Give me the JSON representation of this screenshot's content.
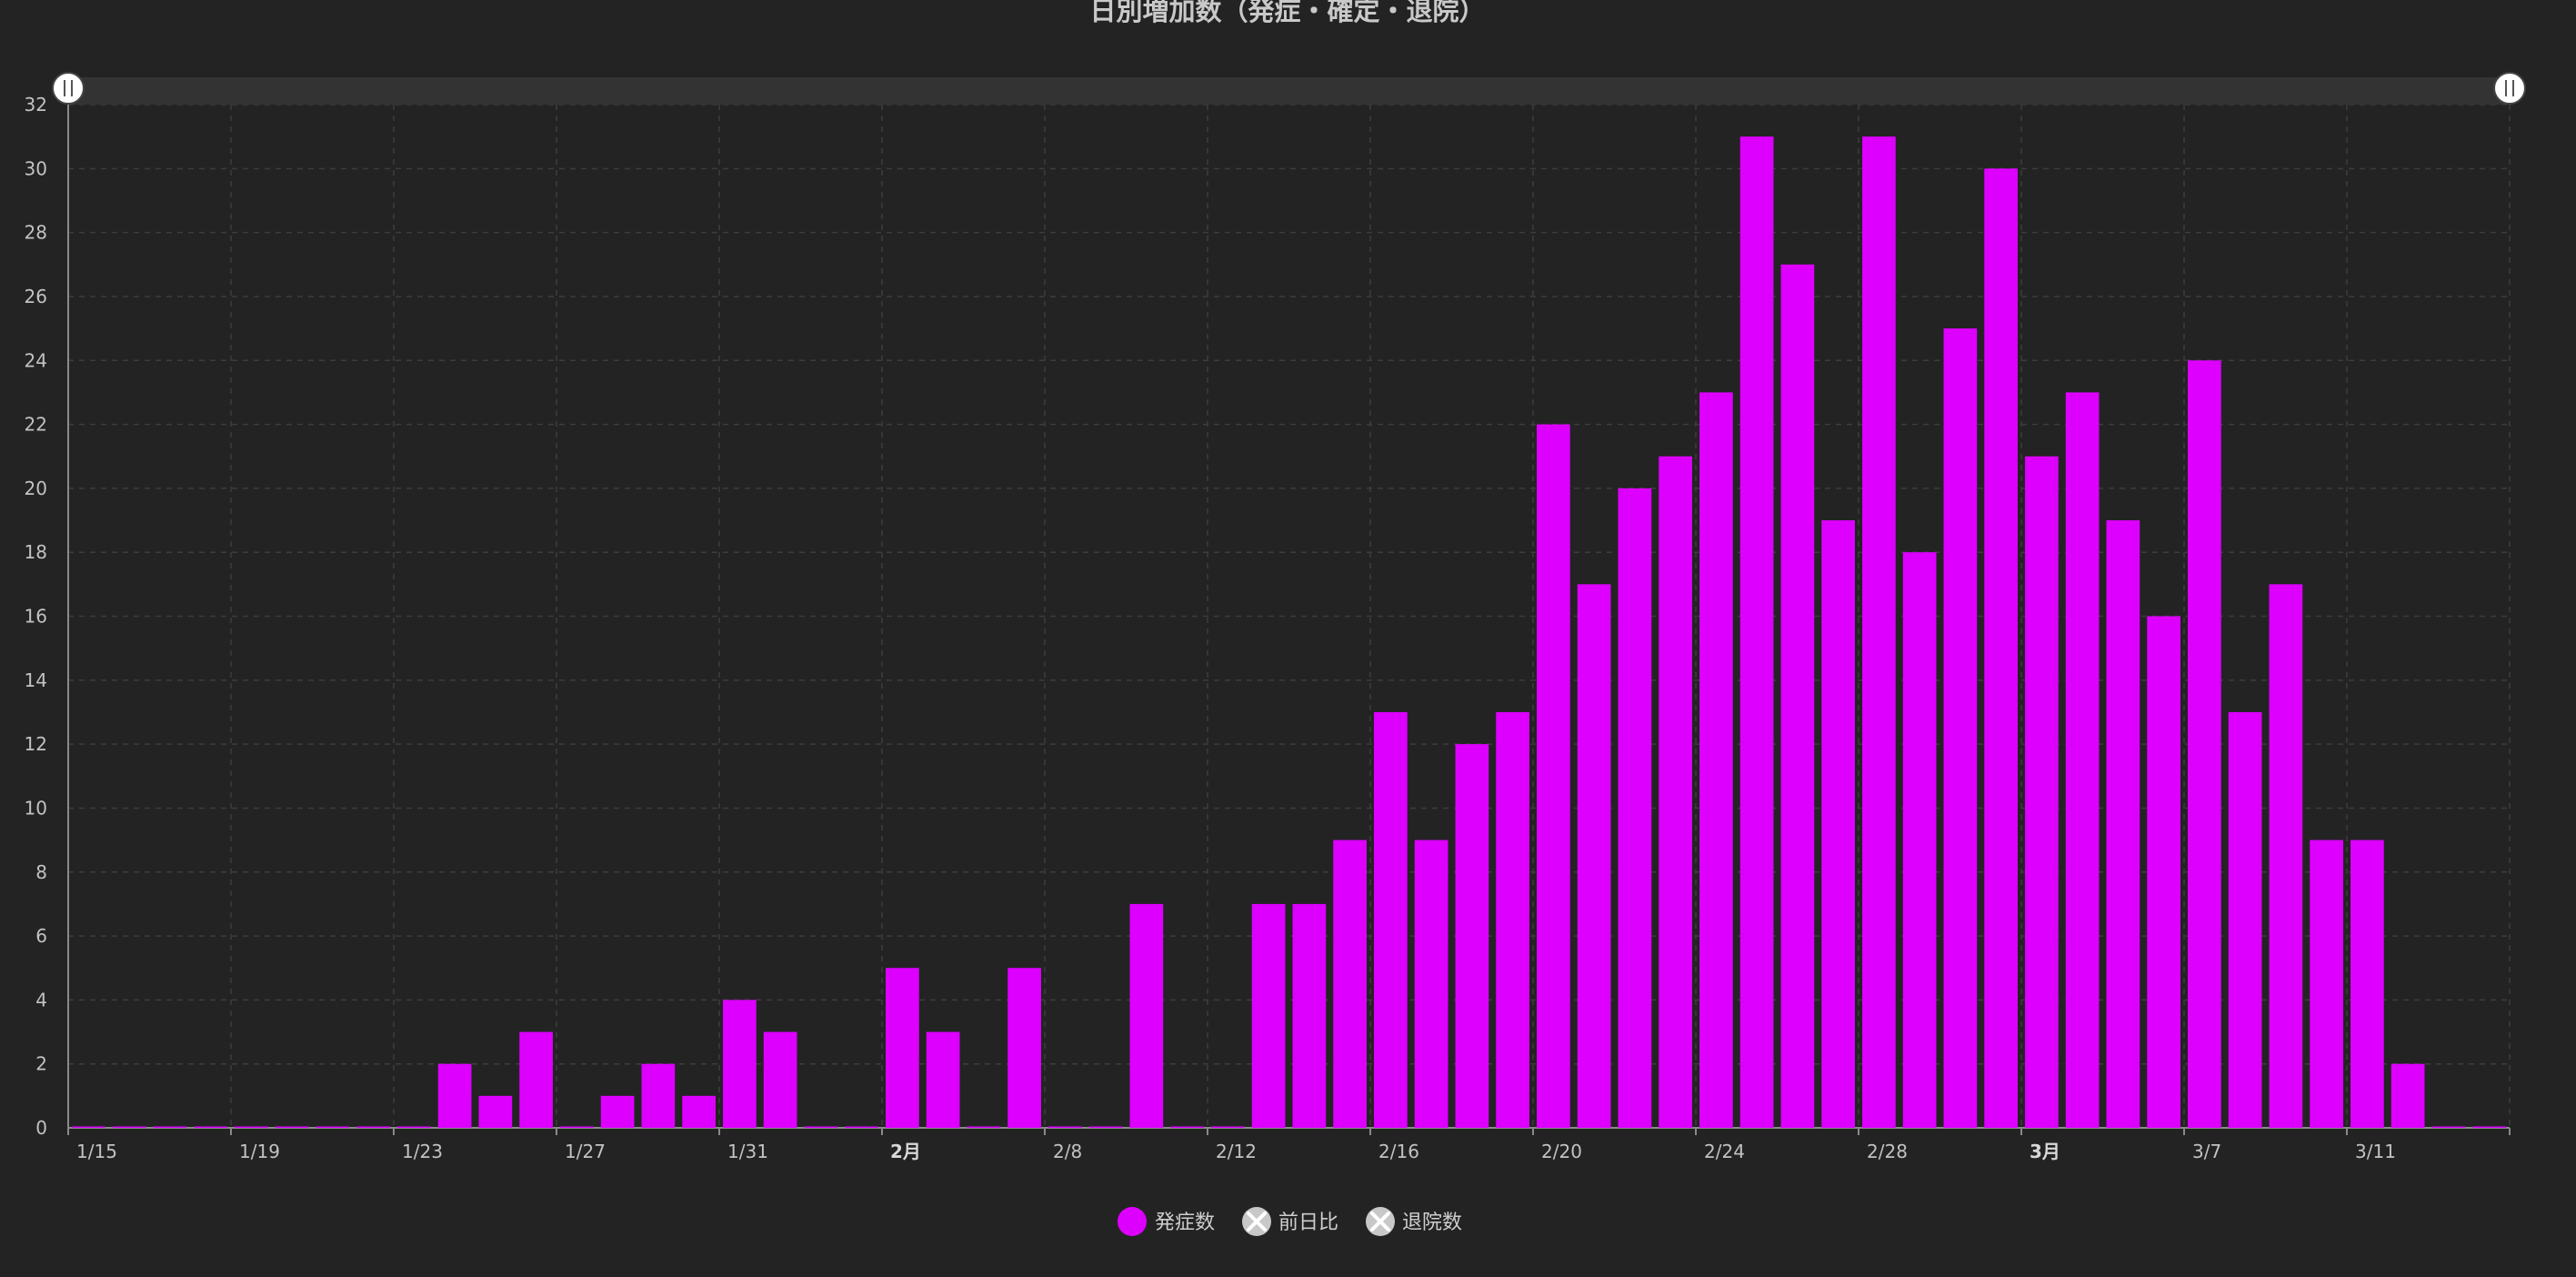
{
  "chart_data": {
    "type": "bar",
    "title": "日別増加数（発症・確定・退院）",
    "categories": [
      "1/15",
      "1/16",
      "1/17",
      "1/18",
      "1/19",
      "1/20",
      "1/21",
      "1/22",
      "1/23",
      "1/24",
      "1/25",
      "1/26",
      "1/27",
      "1/28",
      "1/29",
      "1/30",
      "1/31",
      "2/1",
      "2/2",
      "2/3",
      "2/4",
      "2/5",
      "2/6",
      "2/7",
      "2/8",
      "2/9",
      "2/10",
      "2/11",
      "2/12",
      "2/13",
      "2/14",
      "2/15",
      "2/16",
      "2/17",
      "2/18",
      "2/19",
      "2/20",
      "2/21",
      "2/22",
      "2/23",
      "2/24",
      "2/25",
      "2/26",
      "2/27",
      "2/28",
      "2/29",
      "3/1",
      "3/2",
      "3/3",
      "3/4",
      "3/5",
      "3/6",
      "3/7",
      "3/8",
      "3/9",
      "3/10",
      "3/11",
      "3/12",
      "3/13",
      "3/14"
    ],
    "x_tick_labels": [
      {
        "label": "1/15",
        "index": 0,
        "bold": false
      },
      {
        "label": "1/19",
        "index": 4,
        "bold": false
      },
      {
        "label": "1/23",
        "index": 8,
        "bold": false
      },
      {
        "label": "1/27",
        "index": 12,
        "bold": false
      },
      {
        "label": "1/31",
        "index": 16,
        "bold": false
      },
      {
        "label": "2月",
        "index": 20,
        "bold": true
      },
      {
        "label": "2/8",
        "index": 24,
        "bold": false
      },
      {
        "label": "2/12",
        "index": 28,
        "bold": false
      },
      {
        "label": "2/16",
        "index": 32,
        "bold": false
      },
      {
        "label": "2/20",
        "index": 36,
        "bold": false
      },
      {
        "label": "2/24",
        "index": 40,
        "bold": false
      },
      {
        "label": "2/28",
        "index": 44,
        "bold": false
      },
      {
        "label": "3月",
        "index": 48,
        "bold": true
      },
      {
        "label": "3/7",
        "index": 52,
        "bold": false
      },
      {
        "label": "3/11",
        "index": 56,
        "bold": false
      }
    ],
    "series": [
      {
        "name": "発症数",
        "color": "#dd00ff",
        "values": [
          0,
          0,
          0,
          0,
          0,
          0,
          0,
          0,
          0,
          2,
          1,
          3,
          0,
          1,
          2,
          1,
          4,
          3,
          0,
          0,
          5,
          3,
          0,
          5,
          0,
          0,
          7,
          0,
          0,
          7,
          7,
          9,
          13,
          9,
          12,
          13,
          22,
          17,
          20,
          21,
          23,
          31,
          27,
          19,
          31,
          18,
          25,
          30,
          21,
          23,
          19,
          16,
          24,
          13,
          17,
          9,
          9,
          2,
          0,
          0
        ]
      }
    ],
    "ylim": [
      0,
      32
    ],
    "y_ticks": [
      0,
      2,
      4,
      6,
      8,
      10,
      12,
      14,
      16,
      18,
      20,
      22,
      24,
      26,
      28,
      30,
      32
    ],
    "grid": true,
    "legend": {
      "placement": "bottom-center",
      "items": [
        {
          "label": "発症数",
          "active": true,
          "color": "#dd00ff"
        },
        {
          "label": "前日比",
          "active": false,
          "color": "#c8c8c8"
        },
        {
          "label": "退院数",
          "active": false,
          "color": "#c8c8c8"
        }
      ]
    },
    "xlabel": "",
    "ylabel": ""
  }
}
